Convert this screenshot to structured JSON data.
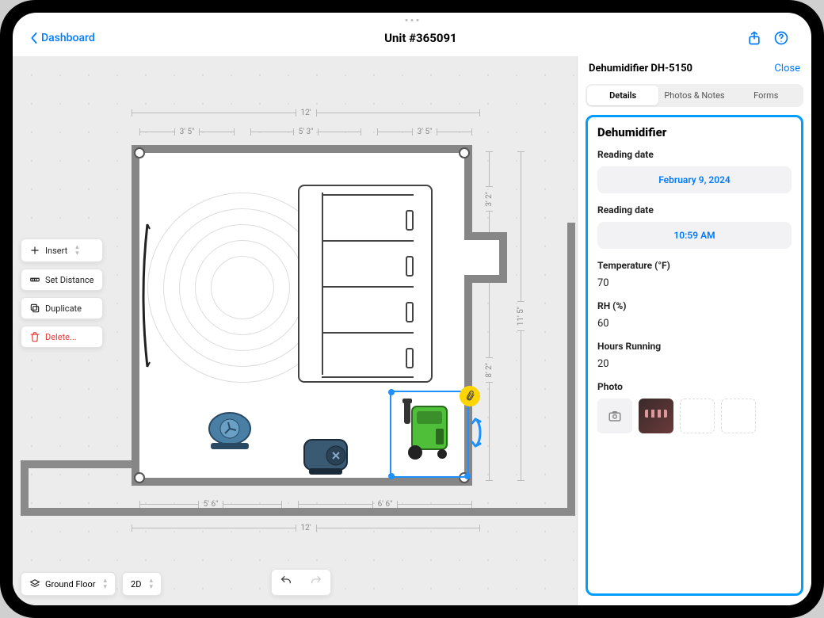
{
  "nav": {
    "back": "Dashboard",
    "title": "Unit #365091"
  },
  "toolbar": {
    "insert": "Insert",
    "set_distance": "Set Distance",
    "duplicate": "Duplicate",
    "delete": "Delete..."
  },
  "bottom": {
    "floor": "Ground Floor",
    "view": "2D"
  },
  "dimensions": {
    "top_total": "12'",
    "top_a": "3' 5\"",
    "top_b": "5' 3\"",
    "top_c": "3' 5\"",
    "right_a": "3' 2\"",
    "right_b": "8' 2\"",
    "right_total": "11' 5\"",
    "bottom_a": "5' 6\"",
    "bottom_b": "6' 6\"",
    "bottom_total": "12'"
  },
  "panel": {
    "title": "Dehumidifier DH-5150",
    "close": "Close",
    "tabs": {
      "details": "Details",
      "photos": "Photos & Notes",
      "forms": "Forms"
    },
    "section_title": "Dehumidifier",
    "fields": {
      "reading_date_label": "Reading date",
      "reading_date_value": "February 9, 2024",
      "reading_time_label": "Reading date",
      "reading_time_value": "10:59 AM",
      "temperature_label": "Temperature (°F)",
      "temperature_value": "70",
      "rh_label": "RH (%)",
      "rh_value": "60",
      "hours_label": "Hours Running",
      "hours_value": "20",
      "photo_label": "Photo"
    }
  }
}
